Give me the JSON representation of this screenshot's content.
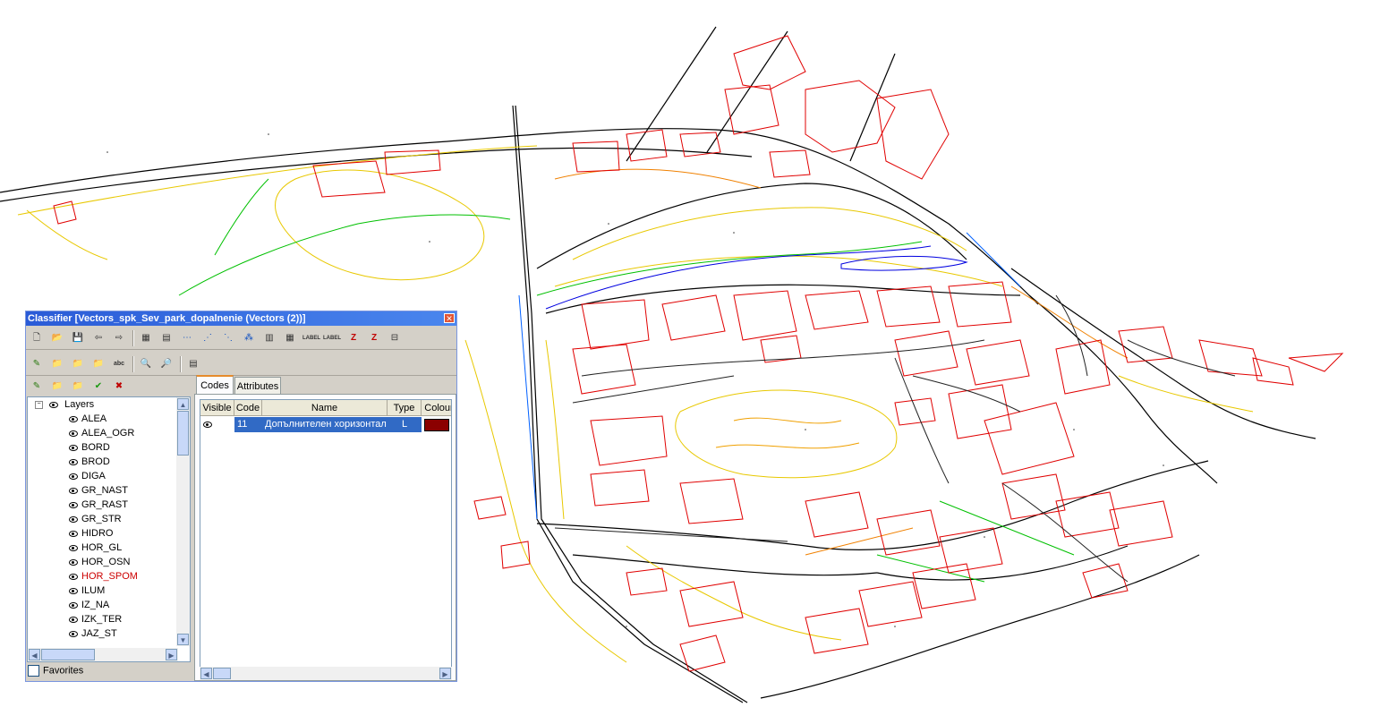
{
  "window": {
    "title": "Classifier [Vectors_spk_Sev_park_dopalnenie (Vectors (2))]",
    "close_icon": "close-icon"
  },
  "toolbar1": [
    "new-icon",
    "open-icon",
    "save-icon",
    "import-icon",
    "export-icon",
    "table-icon",
    "table-small-icon",
    "link-icon",
    "link-alt-icon",
    "unlink-icon",
    "nodes-icon",
    "grid-icon",
    "table-large-icon",
    "label-icon",
    "label-list-icon",
    "z-icon",
    "z-sort-icon",
    "tree-icon"
  ],
  "toolbar2": [
    "layer-edit-icon",
    "layer-open-icon",
    "layer-add-icon",
    "layer-remove-icon",
    "abc-icon",
    "find-icon",
    "find-next-icon",
    "properties-icon"
  ],
  "toolbar3": [
    "code-edit-icon",
    "code-open-icon",
    "code-delete-icon",
    "check-icon",
    "remove-icon"
  ],
  "labels": {
    "label_text": "LABEL",
    "z_text": "Z"
  },
  "tree": {
    "root": "Layers",
    "items": [
      "ALEA",
      "ALEA_OGR",
      "BORD",
      "BROD",
      "DIGA",
      "GR_NAST",
      "GR_RAST",
      "GR_STR",
      "HIDRO",
      "HOR_GL",
      "HOR_OSN",
      "HOR_SPOM",
      "ILUM",
      "IZ_NA",
      "IZK_TER",
      "JAZ_ST"
    ],
    "highlight_index": 11,
    "highlight_color": "#cc0000"
  },
  "favorites": {
    "label": "Favorites",
    "checked": false
  },
  "tabs": [
    "Codes",
    "Attributes"
  ],
  "active_tab": 0,
  "codes_table": {
    "columns": [
      "Visible",
      "Code",
      "Name",
      "Type",
      "Colour"
    ],
    "rows": [
      {
        "visible": true,
        "code": "11",
        "name": "Допълнителен хоризонтал",
        "type": "L",
        "colour": "#8b0000"
      }
    ]
  },
  "colors": {
    "title_bar": "#2a5bd7",
    "selection": "#316ac5",
    "window_bg": "#d4d0c8"
  }
}
